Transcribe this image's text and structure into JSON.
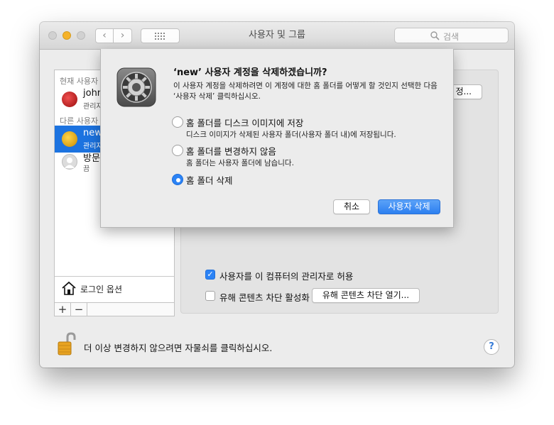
{
  "window": {
    "title": "사용자 및 그룹",
    "search_placeholder": "검색"
  },
  "sidebar": {
    "current_section": "현재 사용자",
    "other_section": "다른 사용자",
    "users": [
      {
        "name": "john",
        "role": "관리자"
      },
      {
        "name": "new",
        "role": "관리자"
      },
      {
        "name": "방문",
        "role": "끔"
      }
    ],
    "login_options_label": "로그인 옵션",
    "add_label": "+",
    "remove_label": "−"
  },
  "panel": {
    "partial_button_label": "정...",
    "allow_admin_label": "사용자를 이 컴퓨터의 관리자로 허용",
    "allow_admin_checked": true,
    "parental_label": "유해 콘텐츠 차단 활성화",
    "parental_checked": false,
    "open_parental_label": "유해 콘텐츠 차단 열기..."
  },
  "footer": {
    "lock_text": "더 이상 변경하지 않으려면 자물쇠를 클릭하십시오.",
    "help_label": "?"
  },
  "dialog": {
    "title": "‘new’ 사용자 계정을 삭제하겠습니까?",
    "message": "이 사용자 계정을 삭제하려면 이 계정에 대한 홈 폴더를 어떻게 할 것인지 선택한 다음 ‘사용자 삭제’ 클릭하십시오.",
    "options": [
      {
        "label": "홈 폴더를 디스크 이미지에 저장",
        "description": "디스크 이미지가 삭제된 사용자 폴더(사용자 폴더 내)에 저장됩니다."
      },
      {
        "label": "홈 폴더를 변경하지 않음",
        "description": "홈 폴더는 사용자 폴더에 남습니다."
      },
      {
        "label": "홈 폴더 삭제",
        "description": ""
      }
    ],
    "selected_option": 2,
    "cancel_label": "취소",
    "confirm_label": "사용자 삭제"
  },
  "colors": {
    "accent": "#2c83f5",
    "selection": "#1c73e0",
    "minimize": "#f5b229"
  }
}
